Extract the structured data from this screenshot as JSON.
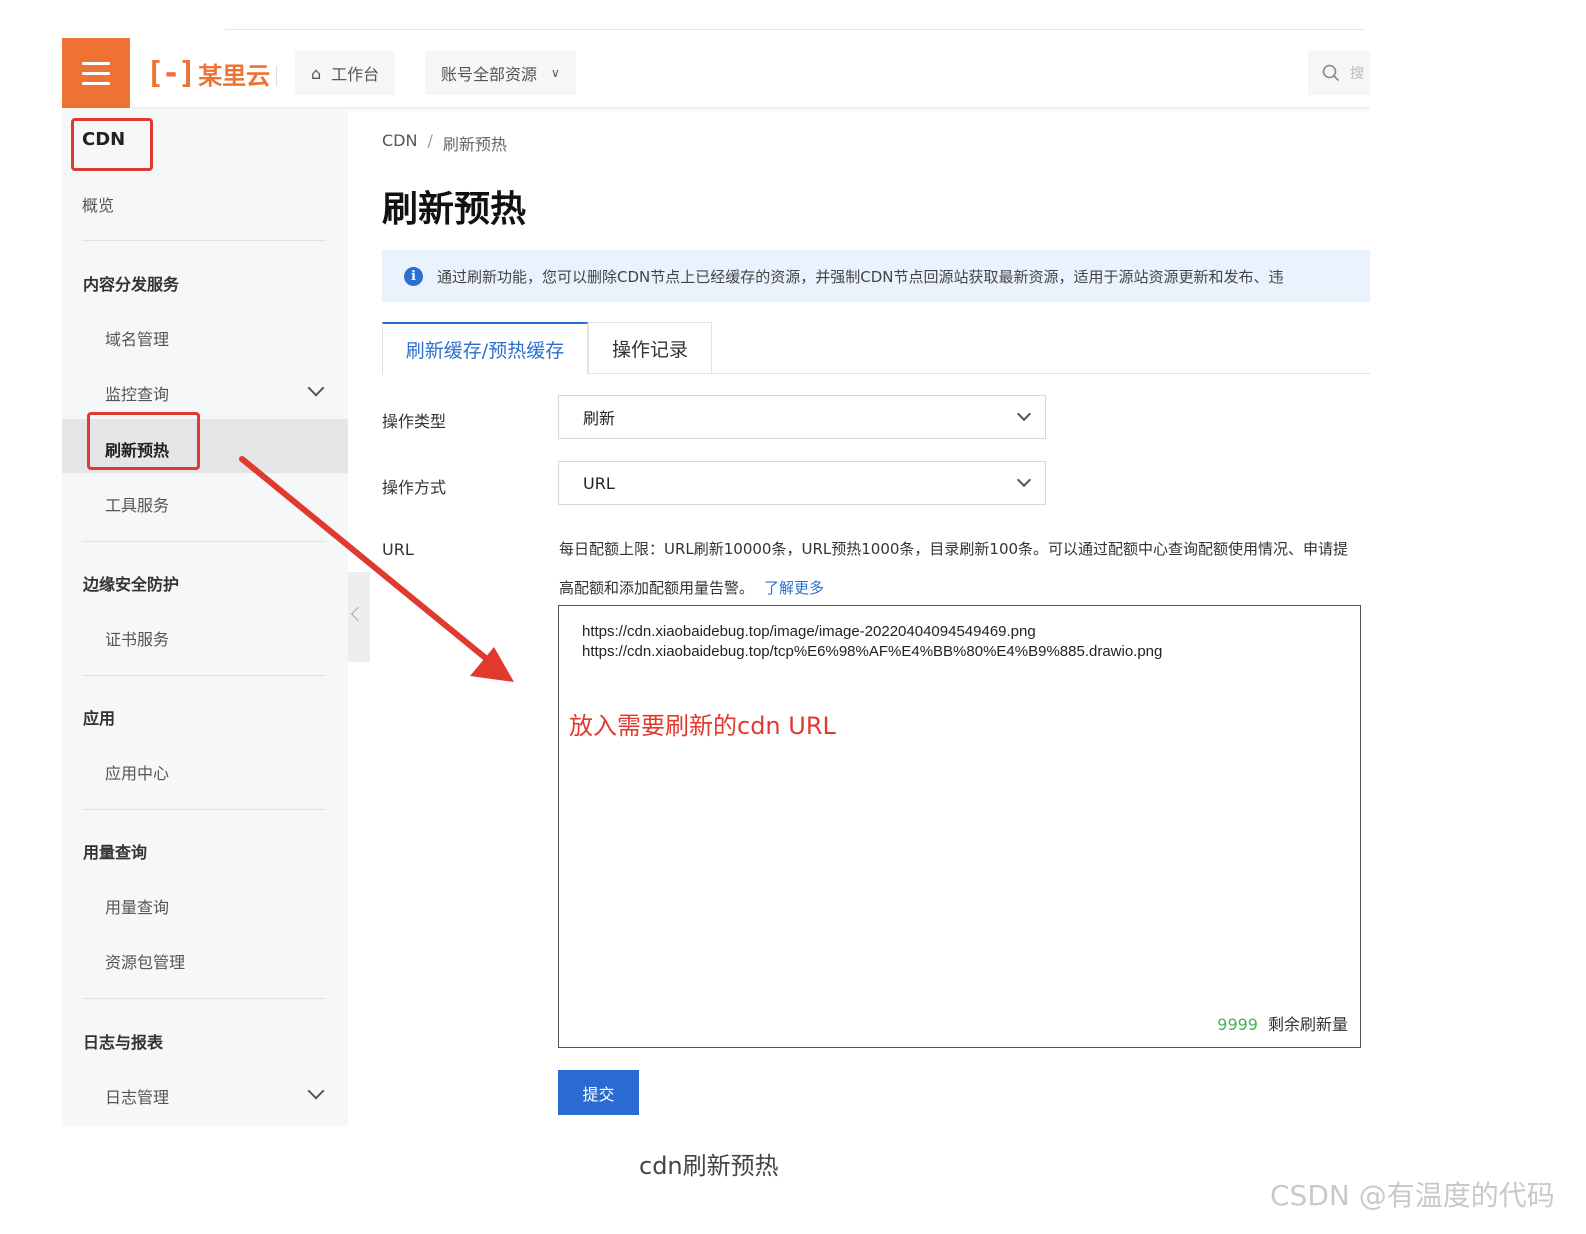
{
  "topbar": {
    "logo_bracket": "[-]",
    "logo_text": "某里云",
    "workbench_label": "工作台",
    "resources_label": "账号全部资源",
    "search_placeholder": "搜"
  },
  "sidebar": {
    "title": "CDN",
    "overview": "概览",
    "groups": [
      {
        "label": "内容分发服务"
      },
      {
        "label": "边缘安全防护"
      },
      {
        "label": "应用"
      },
      {
        "label": "用量查询"
      },
      {
        "label": "日志与报表"
      }
    ],
    "items": {
      "domain_mgmt": "域名管理",
      "monitor_query": "监控查询",
      "refresh_prefetch": "刷新预热",
      "tool_service": "工具服务",
      "cert_service": "证书服务",
      "app_center": "应用中心",
      "usage_query": "用量查询",
      "package_mgmt": "资源包管理",
      "log_mgmt": "日志管理"
    }
  },
  "breadcrumb": {
    "root": "CDN",
    "sep": "/",
    "current": "刷新预热"
  },
  "page_title": "刷新预热",
  "notice": "通过刷新功能，您可以删除CDN节点上已经缓存的资源，并强制CDN节点回源站获取最新资源，适用于源站资源更新和发布、违",
  "tabs": [
    "刷新缓存/预热缓存",
    "操作记录"
  ],
  "form": {
    "op_type_label": "操作类型",
    "op_type_value": "刷新",
    "op_method_label": "操作方式",
    "op_method_value": "URL",
    "url_label": "URL",
    "quota_text": "每日配额上限：URL刷新10000条，URL预热1000条，目录刷新100条。可以通过配额中心查询配额使用情况、申请提高配额和添加配额用量告警。",
    "learn_more": "了解更多",
    "url_lines": [
      "https://cdn.xiaobaidebug.top/image/image-20220404094549469.png",
      "https://cdn.xiaobaidebug.top/tcp%E6%98%AF%E4%BB%80%E4%B9%885.drawio.png"
    ],
    "remaining_count": "9999",
    "remaining_label": "剩余刷新量",
    "submit_label": "提交"
  },
  "annotation": "放入需要刷新的cdn URL",
  "caption": "cdn刷新预热",
  "watermark": "CSDN @有温度的代码",
  "colors": {
    "brand_orange": "#ee7233",
    "primary_blue": "#2a70d0",
    "highlight_red": "#e03a2f"
  }
}
